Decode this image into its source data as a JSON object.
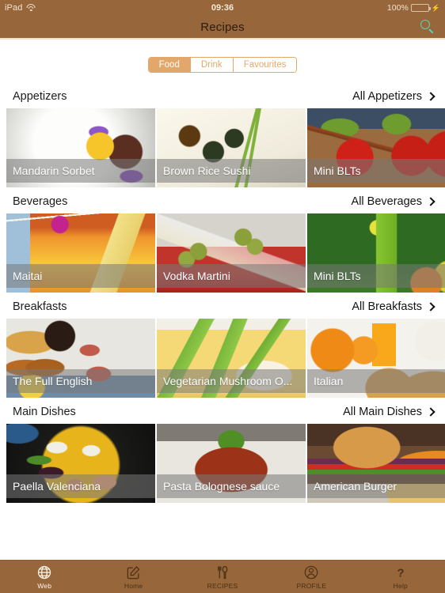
{
  "status_bar": {
    "device": "iPad",
    "wifi_icon": "wifi-icon",
    "time": "09:36",
    "battery_percent": "100%",
    "battery_level": 100,
    "charging_icon": "lightning-bolt-icon"
  },
  "nav_bar": {
    "title": "Recipes",
    "search_icon": "search-icon",
    "background_color": "#97663a",
    "search_icon_color": "#5fd0c0"
  },
  "segmented_control": {
    "options": [
      {
        "label": "Food",
        "selected": true
      },
      {
        "label": "Drink",
        "selected": false
      },
      {
        "label": "Favourites",
        "selected": false
      }
    ],
    "accent_color": "#e2a86b"
  },
  "sections": [
    {
      "title": "Appetizers",
      "more_label": "All Appetizers",
      "more_icon": "chevron-right-icon",
      "cards": [
        {
          "label": "Mandarin Sorbet",
          "art": "ph-sorbet"
        },
        {
          "label": "Brown Rice Sushi",
          "art": "ph-sushi"
        },
        {
          "label": "Mini BLTs",
          "art": "ph-blt"
        }
      ]
    },
    {
      "title": "Beverages",
      "more_label": "All Beverages",
      "more_icon": "chevron-right-icon",
      "cards": [
        {
          "label": "Maitai",
          "art": "ph-maitai"
        },
        {
          "label": "Vodka Martini",
          "art": "ph-martini"
        },
        {
          "label": "Mini BLTs",
          "art": "ph-green"
        }
      ]
    },
    {
      "title": "Breakfasts",
      "more_label": "All Breakfasts",
      "more_icon": "chevron-right-icon",
      "cards": [
        {
          "label": "The Full English",
          "art": "ph-english"
        },
        {
          "label": "Vegetarian Mushroom O...",
          "art": "ph-omelette"
        },
        {
          "label": "Italian",
          "art": "ph-italian"
        }
      ]
    },
    {
      "title": "Main Dishes",
      "more_label": "All Main Dishes",
      "more_icon": "chevron-right-icon",
      "cards": [
        {
          "label": "Paella Valenciana",
          "art": "ph-paella"
        },
        {
          "label": "Pasta Bolognese sauce",
          "art": "ph-bolognese"
        },
        {
          "label": "American Burger",
          "art": "ph-burger"
        }
      ]
    }
  ],
  "tab_bar": {
    "background_color": "#97663a",
    "tabs": [
      {
        "label": "Web",
        "icon": "globe-icon",
        "active": true
      },
      {
        "label": "Home",
        "icon": "compose-square-icon",
        "active": false
      },
      {
        "label": "RECIPES",
        "icon": "fork-knife-icon",
        "active": false
      },
      {
        "label": "PROFILE",
        "icon": "person-circle-icon",
        "active": false
      },
      {
        "label": "Help",
        "icon": "question-mark-icon",
        "active": false
      }
    ]
  }
}
